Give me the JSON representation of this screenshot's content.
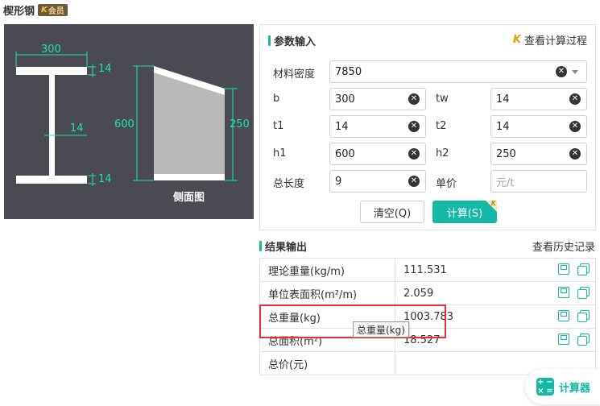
{
  "title": "楔形钢",
  "vip_badge": "会员",
  "vip_badge_mark": "K",
  "diagram": {
    "top_width": "300",
    "top_flange": "14",
    "web": "14",
    "bottom_flange": "14",
    "h1": "600",
    "h2": "250",
    "side_view": "侧面图"
  },
  "params": {
    "header": "参数输入",
    "view_process": "查看计算过程",
    "density": {
      "label": "材料密度",
      "value": "7850"
    },
    "b": {
      "label": "b",
      "value": "300"
    },
    "tw": {
      "label": "tw",
      "value": "14"
    },
    "t1": {
      "label": "t1",
      "value": "14"
    },
    "t2": {
      "label": "t2",
      "value": "14"
    },
    "h1": {
      "label": "h1",
      "value": "600"
    },
    "h2": {
      "label": "h2",
      "value": "250"
    },
    "length": {
      "label": "总长度",
      "value": "9"
    },
    "price": {
      "label": "单价",
      "placeholder": "元/t"
    },
    "clear_button": "清空(Q)",
    "calc_button": "计算(S)"
  },
  "results": {
    "header": "结果输出",
    "history": "查看历史记录",
    "rows": [
      {
        "name": "理论重量(kg/m)",
        "value": "111.531"
      },
      {
        "name": "单位表面积(m²/m)",
        "value": "2.059"
      },
      {
        "name": "总重量(kg)",
        "value": "1003.783"
      },
      {
        "name": "总面积(m²)",
        "value": "18.527"
      },
      {
        "name": "总价(元)",
        "value": ""
      }
    ],
    "tooltip": "总重量(kg)"
  },
  "fab": {
    "label": "计算器"
  },
  "colors": {
    "accent": "#14b8a6",
    "diagram_bg": "#4a4a52",
    "dimension": "#19e6b4",
    "highlight": "#e8312f"
  }
}
